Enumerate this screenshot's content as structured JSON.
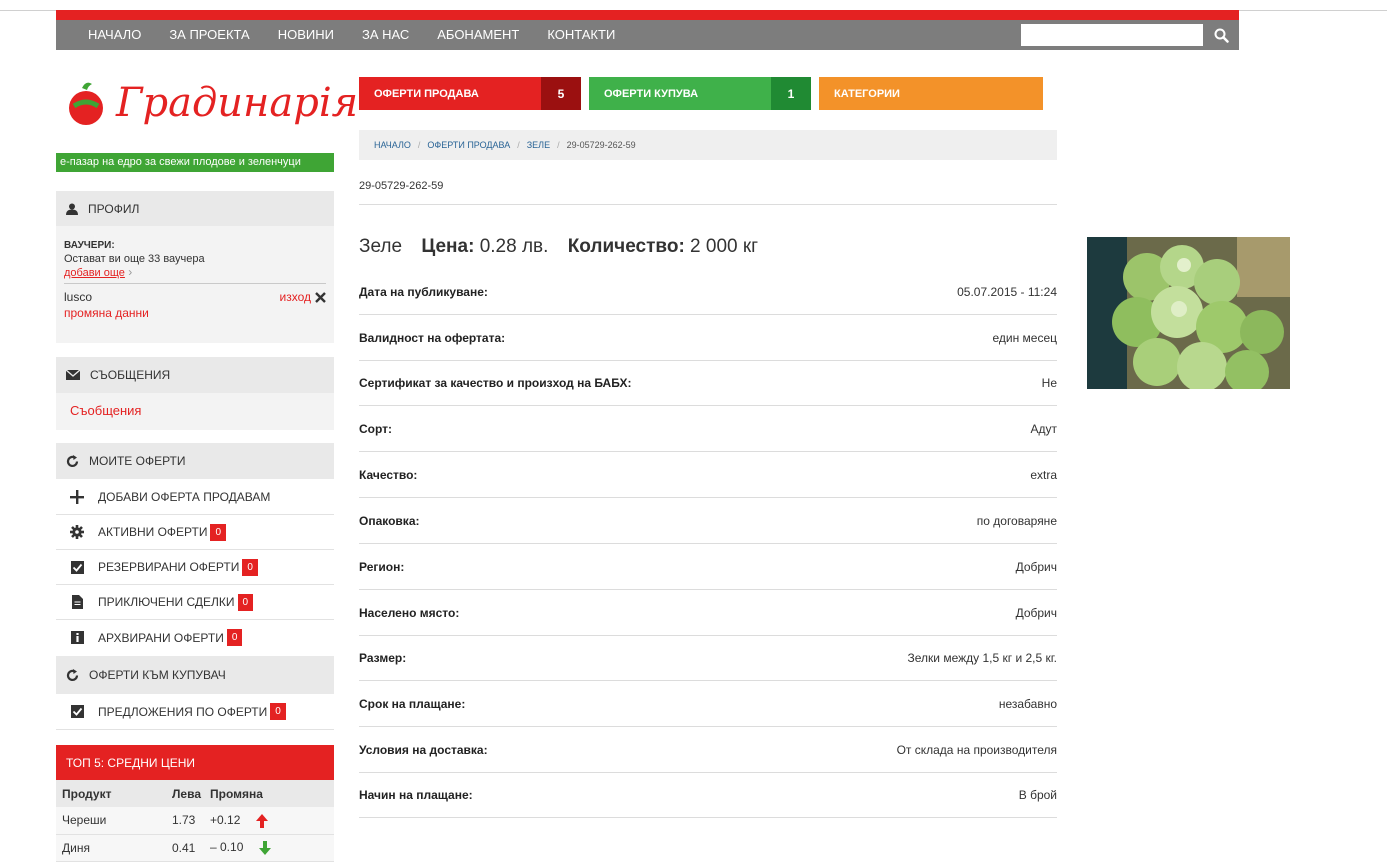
{
  "nav": {
    "items": [
      "НАЧАЛО",
      "ЗА ПРОЕКТА",
      "НОВИНИ",
      "ЗА НАС",
      "АБОНАМЕНТ",
      "КОНТАКТИ"
    ],
    "search_placeholder": ""
  },
  "logo": {
    "name": "Градинарiя",
    "tagline": "е-пазар на едро за свежи плодове и зеленчуци"
  },
  "sidebar": {
    "profile_title": "ПРОФИЛ",
    "voucher_title": "ВАУЧЕРИ:",
    "voucher_text": "Остават ви още 33 ваучера",
    "voucher_link": "добави още",
    "username": "lusco",
    "logout": "изход",
    "change_data": "промяна данни",
    "messages_title": "СЪОБЩЕНИЯ",
    "messages_link": "Съобщения",
    "my_offers_title": "МОИТЕ ОФЕРТИ",
    "offer_items": [
      {
        "label": "ДОБАВИ ОФЕРТА ПРОДАВАМ",
        "badge": null,
        "icon": "plus-icon"
      },
      {
        "label": "АКТИВНИ ОФЕРТИ",
        "badge": "0",
        "icon": "gear-icon"
      },
      {
        "label": "РЕЗЕРВИРАНИ ОФЕРТИ",
        "badge": "0",
        "icon": "checkbox-icon"
      },
      {
        "label": "ПРИКЛЮЧЕНИ СДЕЛКИ",
        "badge": "0",
        "icon": "document-icon"
      },
      {
        "label": "АРХВИРАНИ ОФЕРТИ",
        "badge": "0",
        "icon": "info-icon"
      }
    ],
    "buyer_offers_title": "ОФЕРТИ КЪМ КУПУВАЧ",
    "buyer_items": [
      {
        "label": "ПРЕДЛОЖЕНИЯ ПО ОФЕРТИ",
        "badge": "0",
        "icon": "checkbox-icon"
      }
    ],
    "top5": {
      "title": "ТОП 5: СРЕДНИ ЦЕНИ",
      "headers": [
        "Продукт",
        "Лева",
        "Промяна"
      ],
      "rows": [
        {
          "product": "Череши",
          "price": "1.73",
          "change": "+0.12",
          "trend": "up"
        },
        {
          "product": "Диня",
          "price": "0.41",
          "change": "– 0.10",
          "trend": "down"
        }
      ]
    }
  },
  "tabs": [
    {
      "label": "ОФЕРТИ ПРОДАВА",
      "count": "5",
      "color": "#e42222",
      "count_bg": "#9b1010"
    },
    {
      "label": "ОФЕРТИ КУПУВА",
      "count": "1",
      "color": "#3fb14a",
      "count_bg": "#208a33"
    },
    {
      "label": "КАТЕГОРИИ",
      "count": null,
      "color": "#f39229",
      "count_bg": null
    }
  ],
  "breadcrumb": [
    "НАЧАЛО",
    "ОФЕРТИ ПРОДАВА",
    "ЗЕЛЕ",
    "29-05729-262-59"
  ],
  "offer": {
    "id": "29-05729-262-59",
    "product": "Зеле",
    "price_label": "Цена:",
    "price_value": "0.28 лв.",
    "qty_label": "Количество:",
    "qty_value": "2 000 кг",
    "details": [
      {
        "label": "Дата на публикуване:",
        "value": "05.07.2015 - 11:24"
      },
      {
        "label": "Валидност на офертата:",
        "value": "един месец"
      },
      {
        "label": "Сертификат за качество и произход на БАБХ:",
        "value": "Не"
      },
      {
        "label": "Сорт:",
        "value": "Адут"
      },
      {
        "label": "Качество:",
        "value": "extra"
      },
      {
        "label": "Опаковка:",
        "value": "по договаряне"
      },
      {
        "label": "Регион:",
        "value": "Добрич"
      },
      {
        "label": "Населено място:",
        "value": "Добрич"
      },
      {
        "label": "Размер:",
        "value": "Зелки между 1,5 кг и 2,5 кг."
      },
      {
        "label": "Срок на плащане:",
        "value": "незабавно"
      },
      {
        "label": "Условия на доставка:",
        "value": "От склада на производителя"
      },
      {
        "label": "Начин на плащане:",
        "value": "В брой"
      }
    ]
  },
  "colors": {
    "accent_red": "#e42222",
    "green": "#3fa535",
    "orange": "#f39229",
    "nav_gray": "#7d7d7d"
  }
}
